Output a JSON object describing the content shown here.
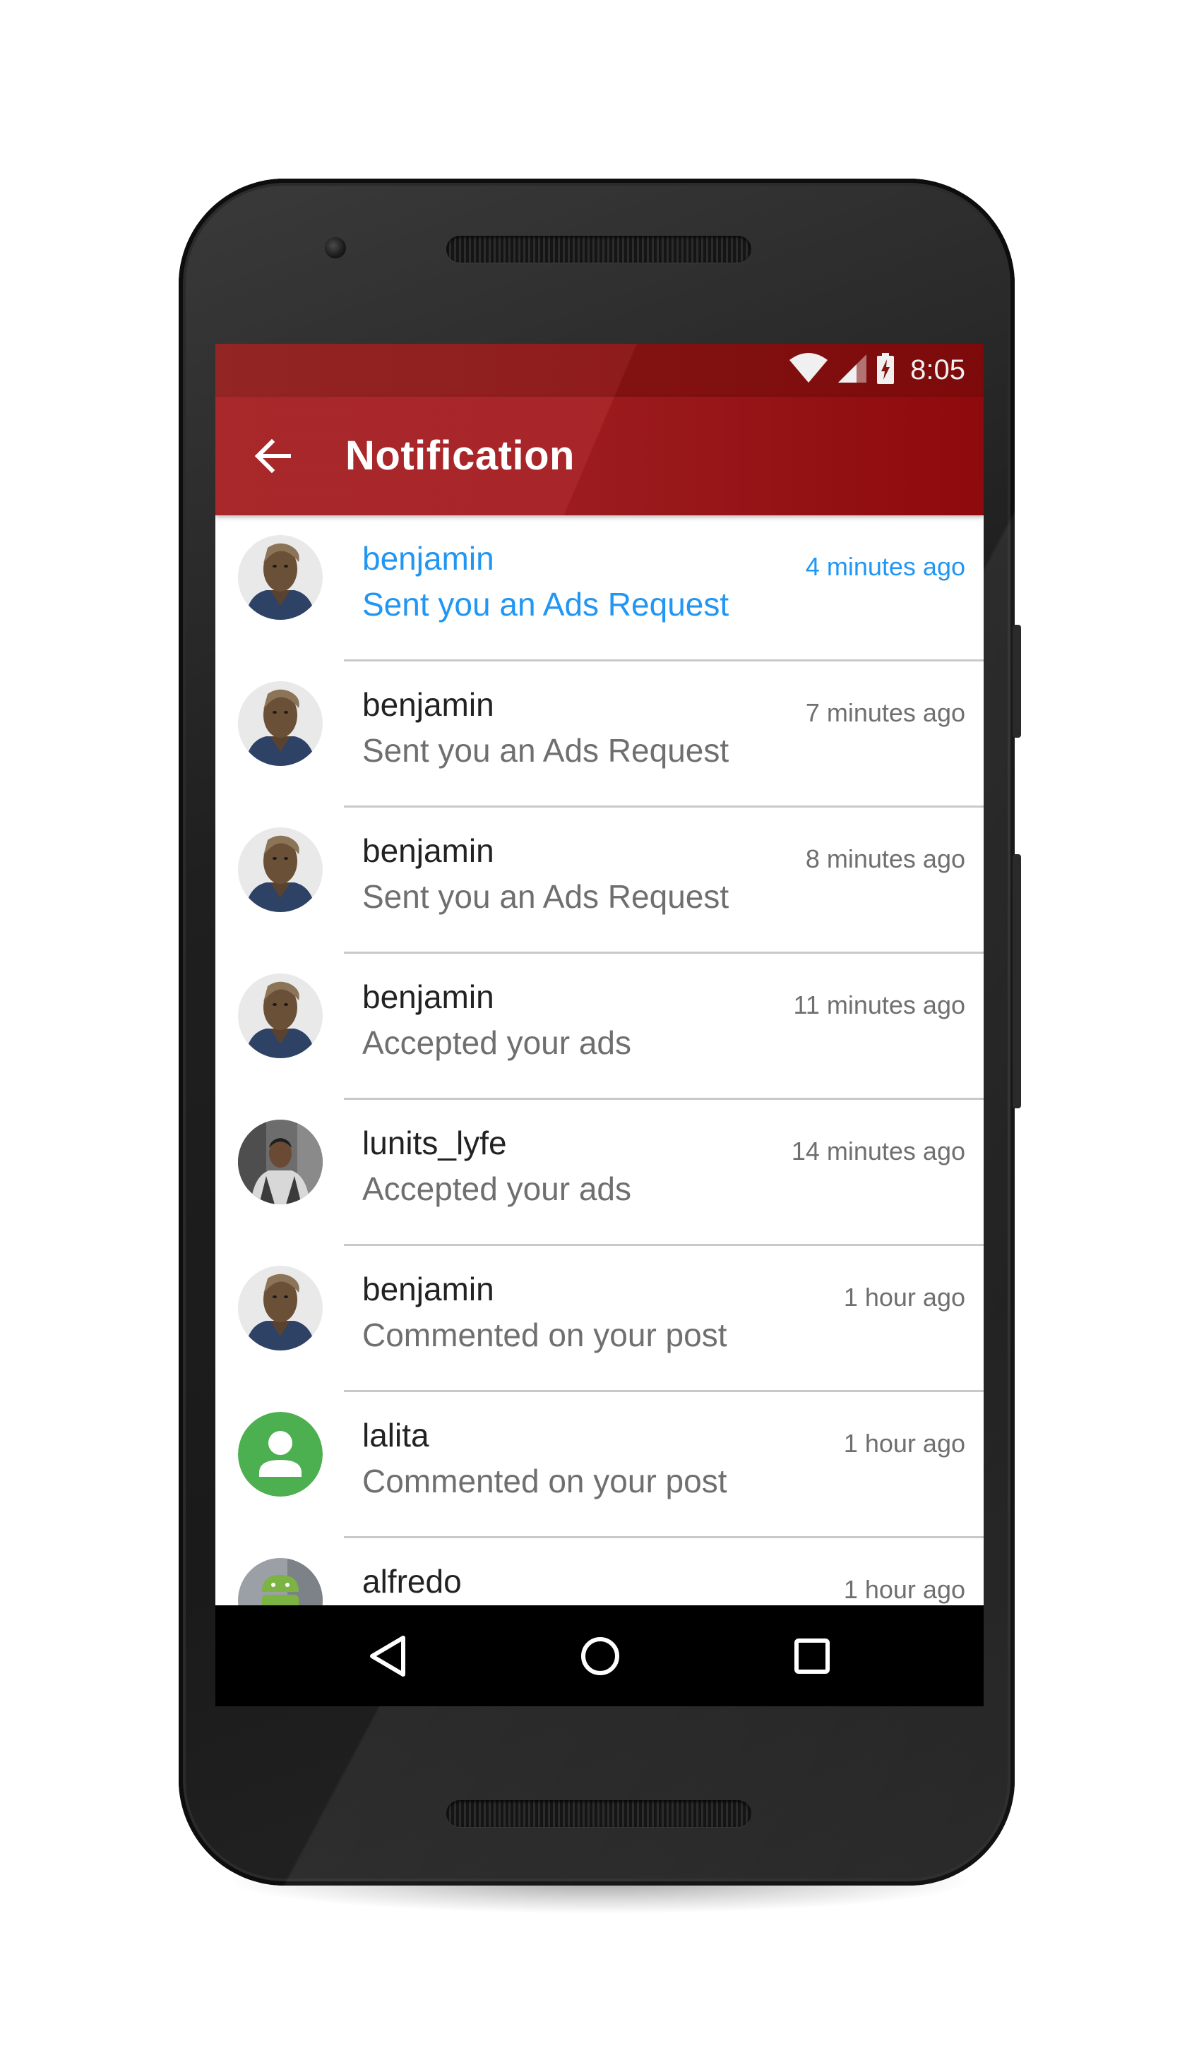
{
  "status_bar": {
    "time": "8:05",
    "icons": [
      "wifi-icon",
      "cell-signal-icon",
      "battery-charging-icon"
    ]
  },
  "app_bar": {
    "title": "Notification",
    "back_icon": "arrow-back-icon"
  },
  "colors": {
    "status_bar": "#8c1515",
    "app_bar": "#a51d20",
    "unread_accent": "#2196f3",
    "primary_text": "#222222",
    "secondary_text": "#6f6f6f",
    "divider": "#c9c9c9",
    "default_avatar": "#4caf50"
  },
  "notifications": [
    {
      "name": "benjamin",
      "message": "Sent you an Ads Request",
      "time": "4 minutes ago",
      "unread": true,
      "avatar": "wookiee-photo"
    },
    {
      "name": "benjamin",
      "message": "Sent you an Ads Request",
      "time": "7 minutes ago",
      "unread": false,
      "avatar": "wookiee-photo"
    },
    {
      "name": "benjamin",
      "message": "Sent you an Ads Request",
      "time": "8 minutes ago",
      "unread": false,
      "avatar": "wookiee-photo"
    },
    {
      "name": "benjamin",
      "message": "Accepted your ads",
      "time": "11 minutes ago",
      "unread": false,
      "avatar": "wookiee-photo"
    },
    {
      "name": "lunits_lyfe",
      "message": "Accepted your ads",
      "time": "14 minutes ago",
      "unread": false,
      "avatar": "person-photo"
    },
    {
      "name": "benjamin",
      "message": "Commented on your post",
      "time": "1 hour ago",
      "unread": false,
      "avatar": "wookiee-photo"
    },
    {
      "name": "lalita",
      "message": "Commented on your post",
      "time": "1 hour ago",
      "unread": false,
      "avatar": "default-person-icon"
    },
    {
      "name": "alfredo",
      "message": "",
      "time": "1 hour ago",
      "unread": false,
      "avatar": "android-photo"
    }
  ],
  "nav_bar": {
    "back_icon": "nav-back-icon",
    "home_icon": "nav-home-icon",
    "recents_icon": "nav-recents-icon"
  }
}
